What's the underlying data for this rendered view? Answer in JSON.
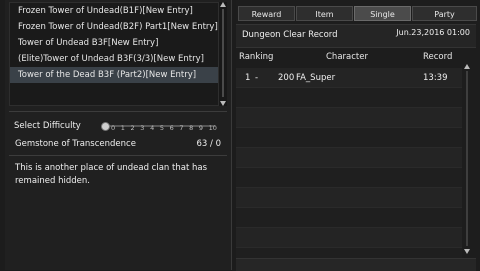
{
  "dungeon_list": {
    "items": [
      {
        "label": "Frozen Tower of Undead(B1F)[New Entry]",
        "selected": false
      },
      {
        "label": "Frozen Tower of Undead(B2F) Part1[New Entry]",
        "selected": false
      },
      {
        "label": "Tower of Undead B3F[New Entry]",
        "selected": false
      },
      {
        "label": "(Elite)Tower of Undead B3F(3/3)[New Entry]",
        "selected": false
      },
      {
        "label": "Tower of the Dead B3F (Part2)[New Entry]",
        "selected": true
      }
    ]
  },
  "difficulty": {
    "label": "Select Difficulty",
    "ticks": [
      "0",
      "1",
      "2",
      "3",
      "4",
      "5",
      "6",
      "7",
      "8",
      "9",
      "10"
    ],
    "value": 0
  },
  "gemstone": {
    "name": "Gemstone of Transcendence",
    "count": "63 / 0"
  },
  "description": "This is another place of undead clan that has remained hidden.",
  "tabs": [
    {
      "label": "Reward",
      "active": false
    },
    {
      "label": "Item",
      "active": false
    },
    {
      "label": "Single",
      "active": true
    },
    {
      "label": "Party",
      "active": false
    }
  ],
  "record": {
    "title": "Dungeon Clear Record",
    "date": "Jun.23,2016 01:00",
    "columns": {
      "ranking": "Ranking",
      "character": "Character",
      "record": "Record"
    },
    "rows": [
      {
        "rank": "1",
        "dash": "-",
        "level": "200",
        "name": "FA_Super",
        "time": "13:39"
      }
    ]
  }
}
